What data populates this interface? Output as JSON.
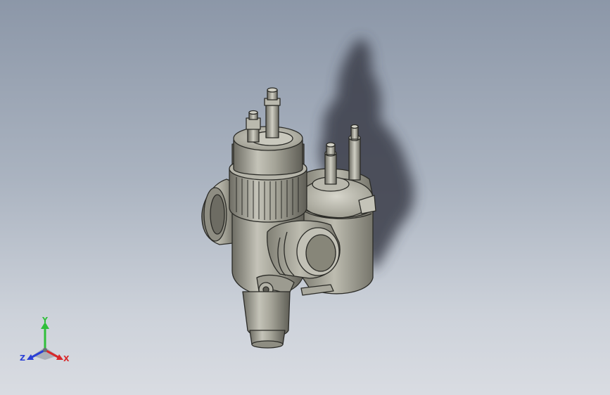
{
  "viewport": {
    "background_top": "#8c97a8",
    "background_bottom": "#d9dce2",
    "model_color": "#a7a69a",
    "shadow_color": "#3a3e48"
  },
  "model": {
    "icon": "carburetor-3d-model-icon"
  },
  "triad": {
    "axes": [
      {
        "key": "y",
        "label": "Y",
        "color": "#2fbf3a",
        "icon": "y-axis-arrow-icon"
      },
      {
        "key": "z",
        "label": "Z",
        "color": "#2a3fd6",
        "icon": "z-axis-arrow-icon"
      },
      {
        "key": "x",
        "label": "X",
        "color": "#d8282a",
        "icon": "x-axis-arrow-icon"
      }
    ]
  }
}
